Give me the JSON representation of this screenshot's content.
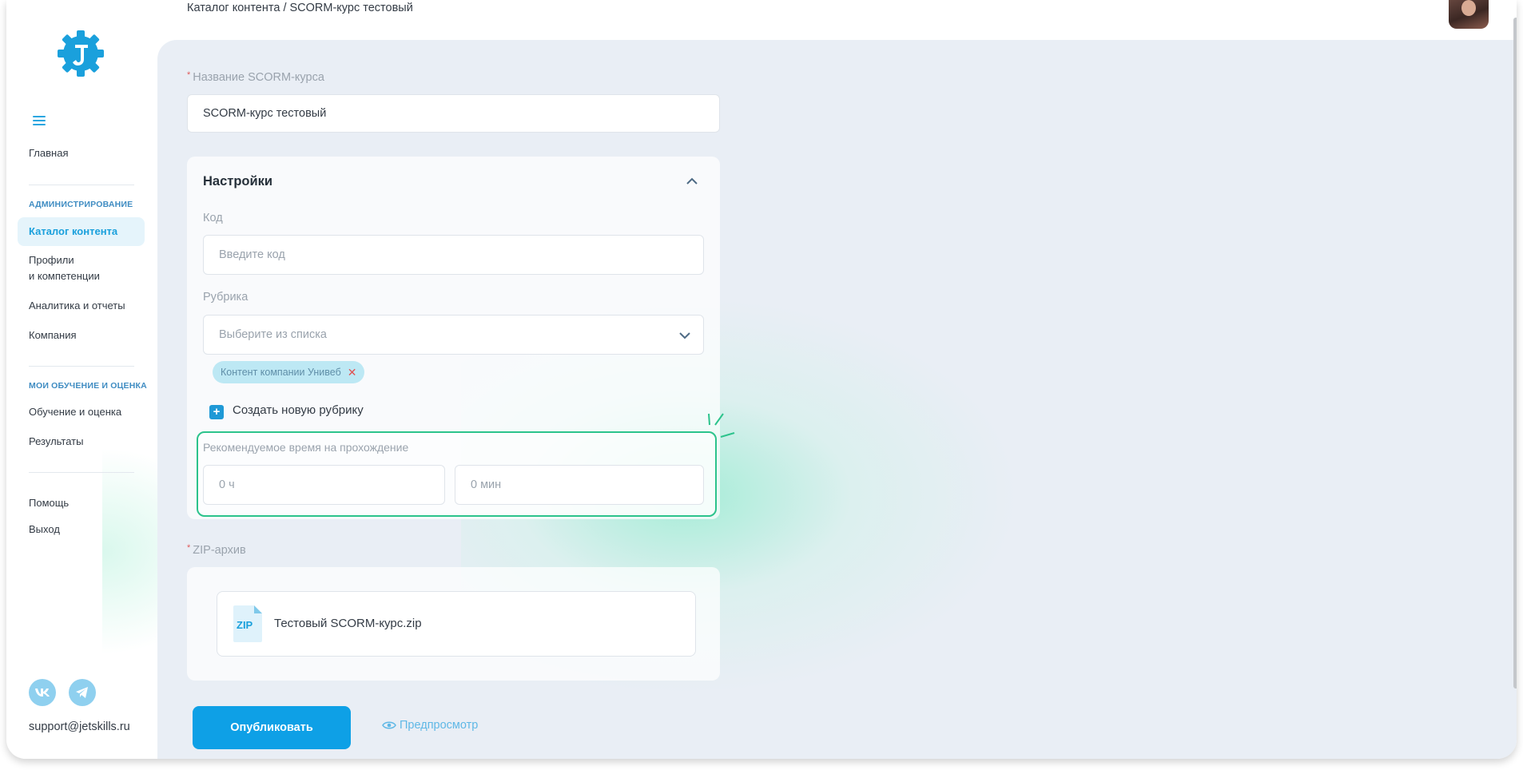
{
  "breadcrumb": "Каталог контента / SCORM-курс тестовый",
  "sidebar": {
    "home": "Главная",
    "admin_section": "АДМИНИСТРИРОВАНИЕ",
    "catalog": "Каталог контента",
    "profiles_line1": "Профили",
    "profiles_line2": "и компетенции",
    "analytics": "Аналитика и отчеты",
    "company": "Компания",
    "learning_section": "МОИ ОБУЧЕНИЕ И ОЦЕНКА",
    "learning": "Обучение и оценка",
    "results": "Результаты",
    "help": "Помощь",
    "logout": "Выход",
    "support_email": "support@jetskills.ru"
  },
  "form": {
    "name_label": "Название SCORM-курса",
    "name_value": "SCORM-курс тестовый",
    "settings_title": "Настройки",
    "code_label": "Код",
    "code_placeholder": "Введите код",
    "rubric_label": "Рубрика",
    "rubric_placeholder": "Выберите из списка",
    "rubric_tag": "Контент компании Унивеб",
    "create_rubric": "Создать новую рубрику",
    "time_label": "Рекомендуемое время на прохождение",
    "hours_placeholder": "0 ч",
    "minutes_placeholder": "0 мин",
    "zip_label": "ZIP-архив",
    "zip_icon_text": "ZIP",
    "zip_file": "Тестовый SCORM-курс.zip",
    "publish": "Опубликовать",
    "preview": "Предпросмотр"
  },
  "colors": {
    "accent": "#0ea0e6",
    "highlight": "#2cc38c",
    "background": "#e9eef5"
  }
}
